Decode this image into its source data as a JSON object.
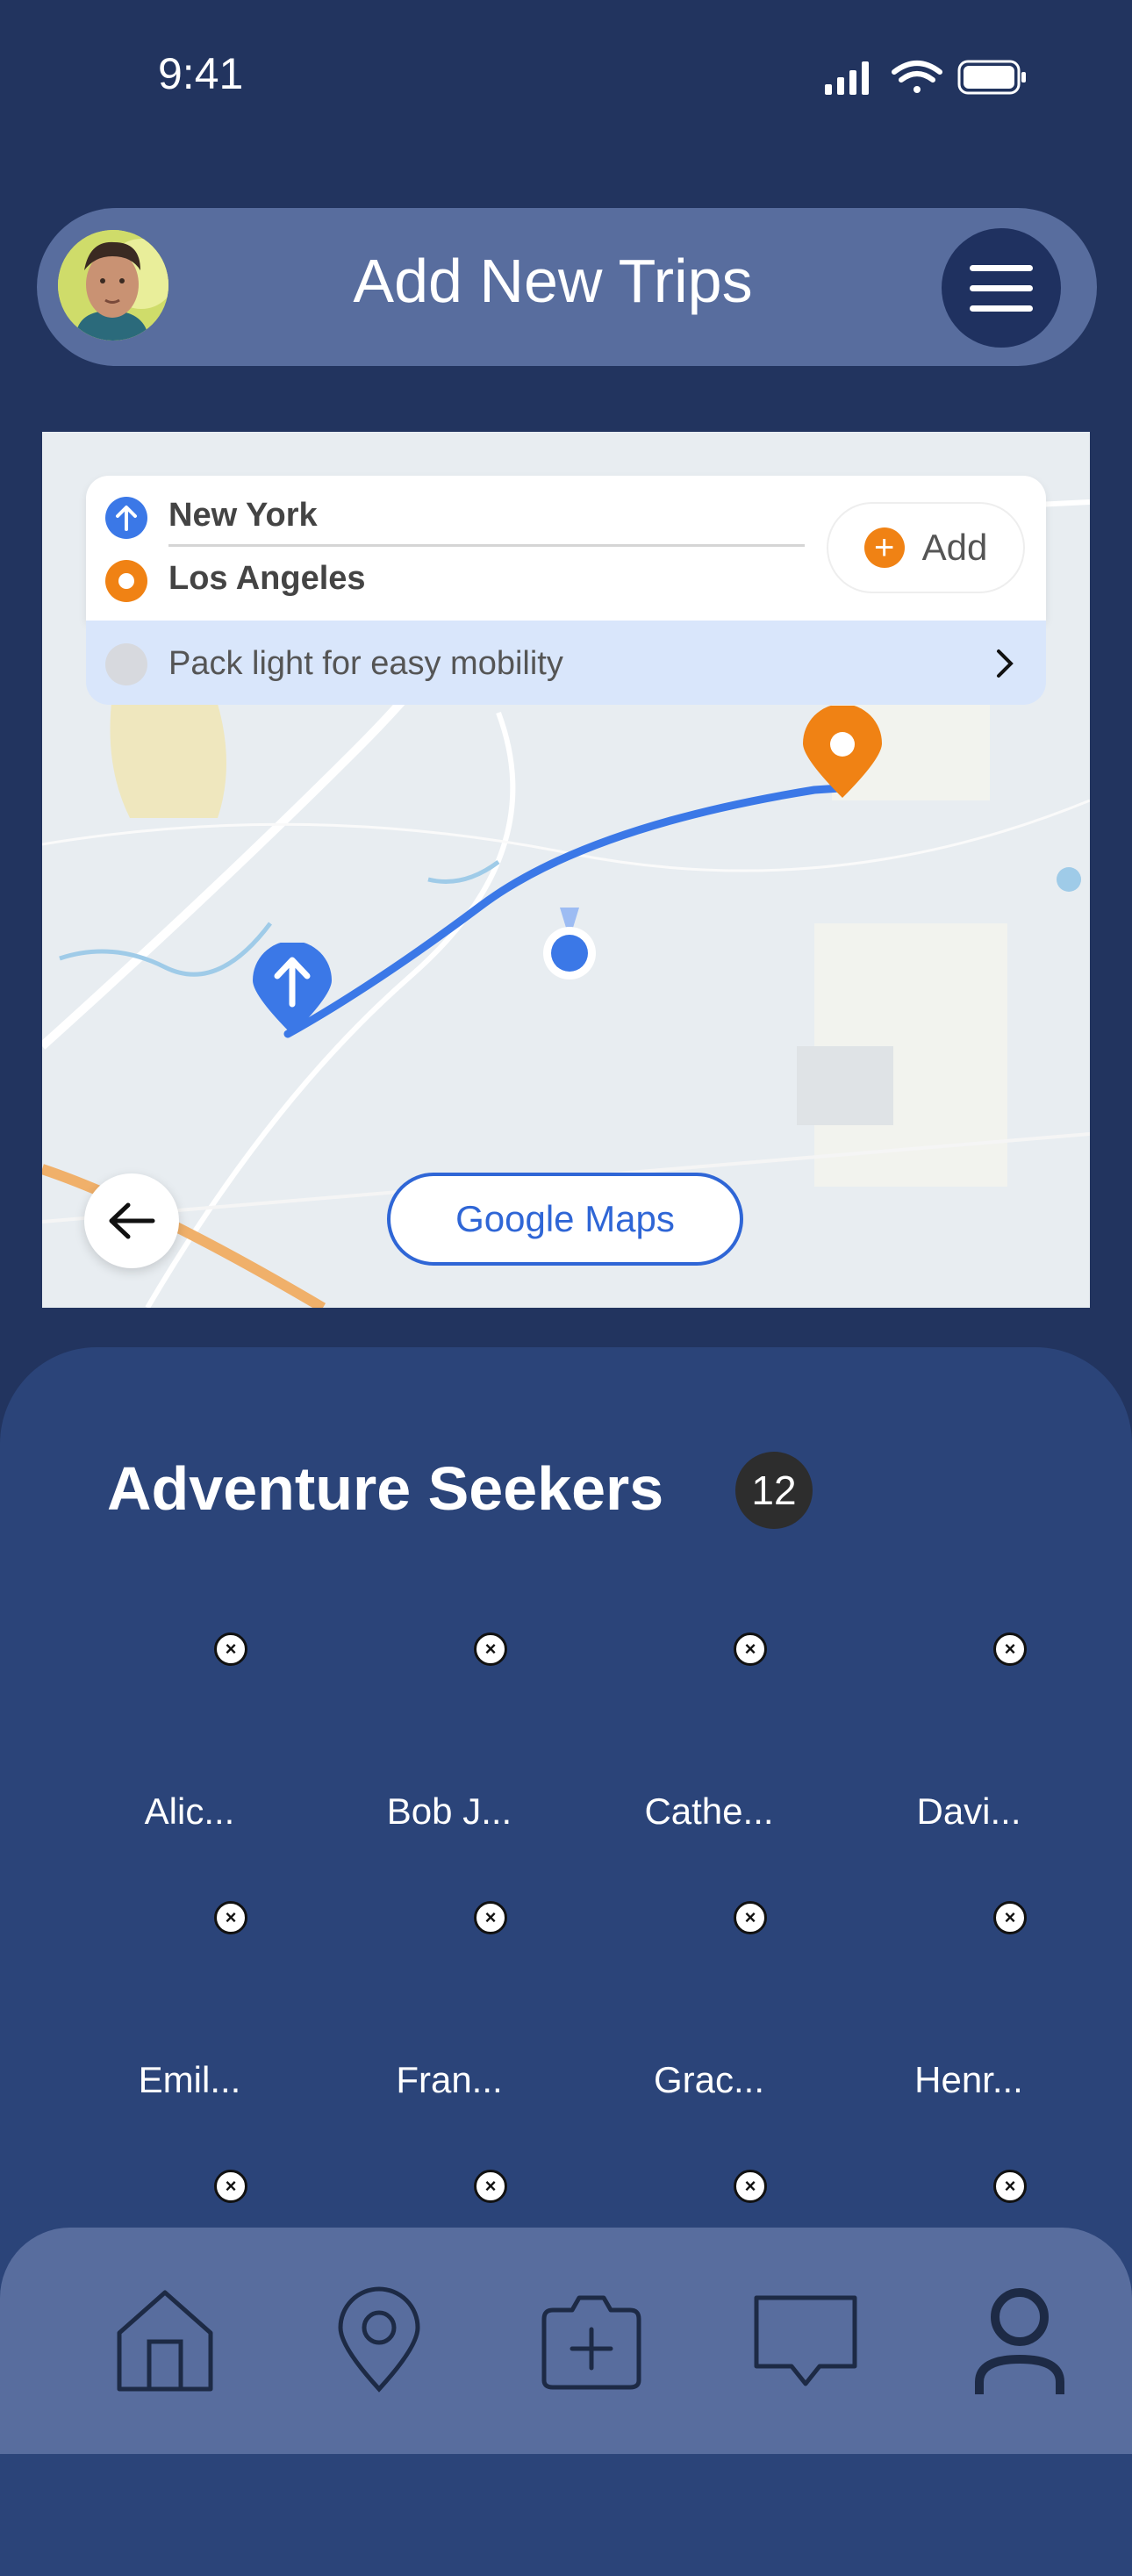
{
  "status_bar": {
    "time": "9:41"
  },
  "header": {
    "title": "Add New Trips",
    "avatar_icon": "user-avatar",
    "menu_icon": "hamburger-menu-icon"
  },
  "route": {
    "from": "New York",
    "to": "Los Angeles",
    "add_label": "Add",
    "tip": "Pack light for easy mobility"
  },
  "map": {
    "google_maps_label": "Google Maps",
    "route_color": "#3b78e7",
    "destination_color": "#f08214"
  },
  "group": {
    "title": "Adventure Seekers",
    "count": "12",
    "members": [
      {
        "name": "Alic..."
      },
      {
        "name": "Bob J..."
      },
      {
        "name": "Cathe..."
      },
      {
        "name": "Davi..."
      },
      {
        "name": "Emil..."
      },
      {
        "name": "Fran..."
      },
      {
        "name": "Grac..."
      },
      {
        "name": "Henr..."
      },
      {
        "name": ""
      },
      {
        "name": ""
      },
      {
        "name": ""
      },
      {
        "name": ""
      }
    ]
  },
  "nav": {
    "items": [
      {
        "icon": "home-icon"
      },
      {
        "icon": "location-pin-icon"
      },
      {
        "icon": "camera-add-icon"
      },
      {
        "icon": "chat-icon"
      },
      {
        "icon": "profile-icon"
      }
    ]
  }
}
